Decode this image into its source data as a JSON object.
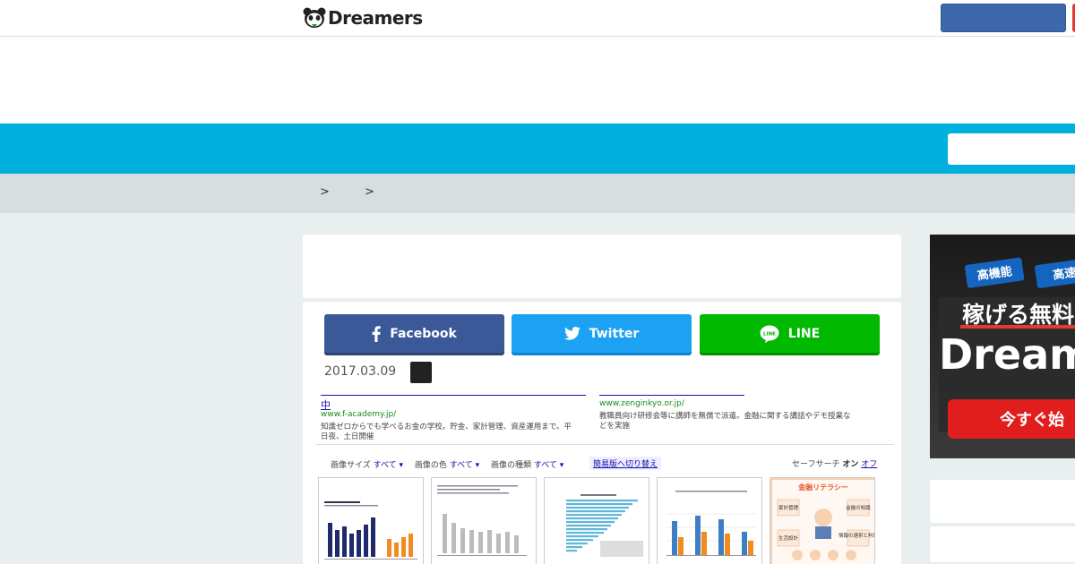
{
  "header": {
    "logo_text": "Dreamers",
    "logo_icon": "panda-icon",
    "primary_button_color": "#3e68ac",
    "secondary_button_color": "#e53935"
  },
  "nav": {
    "bar_color": "#00b0dc"
  },
  "breadcrumb": {
    "separators": [
      ">",
      ">"
    ]
  },
  "share": {
    "facebook_label": "Facebook",
    "twitter_label": "Twitter",
    "line_label": "LINE",
    "line_icon_text": "LINE",
    "facebook_color": "#3b5998",
    "twitter_color": "#1da1f2",
    "line_color": "#00b900"
  },
  "article": {
    "date": "2017.03.09"
  },
  "embedded_screenshot": {
    "result1_title": "中",
    "result1_url": "www.f-academy.jp/",
    "result1_desc_line1": "知識ゼロからでも学べるお金の学校。貯金、家計管理、資産運用まで。平",
    "result1_desc_line2": "日夜、土日開催",
    "result2_url": "www.zenginkyo.or.jp/",
    "result2_desc_line1": "教職員向け研修会等に講師を無償で派遣。金融に関する講話やデモ授業な",
    "result2_desc_line2": "どを実施",
    "filter_size_label": "画像サイズ",
    "filter_size_value": "すべて ▾",
    "filter_color_label": "画像の色",
    "filter_color_value": "すべて ▾",
    "filter_type_label": "画像の種類",
    "filter_type_value": "すべて ▾",
    "simple_version_link": "簡易版へ切り替え",
    "safe_search_label": "セーフサーチ",
    "safe_search_on": "オン",
    "safe_search_off": "オフ",
    "thumb5_caption": "金融リテラシー",
    "thumb5_labels": [
      "家計管理",
      "金融の知識",
      "生活設計",
      "情報の選択と判断"
    ]
  },
  "sidebar_ad": {
    "tag1": "高機能",
    "tag2": "高速",
    "headline": "稼げる無料",
    "brand": "Dream",
    "cta": "今すぐ始"
  }
}
